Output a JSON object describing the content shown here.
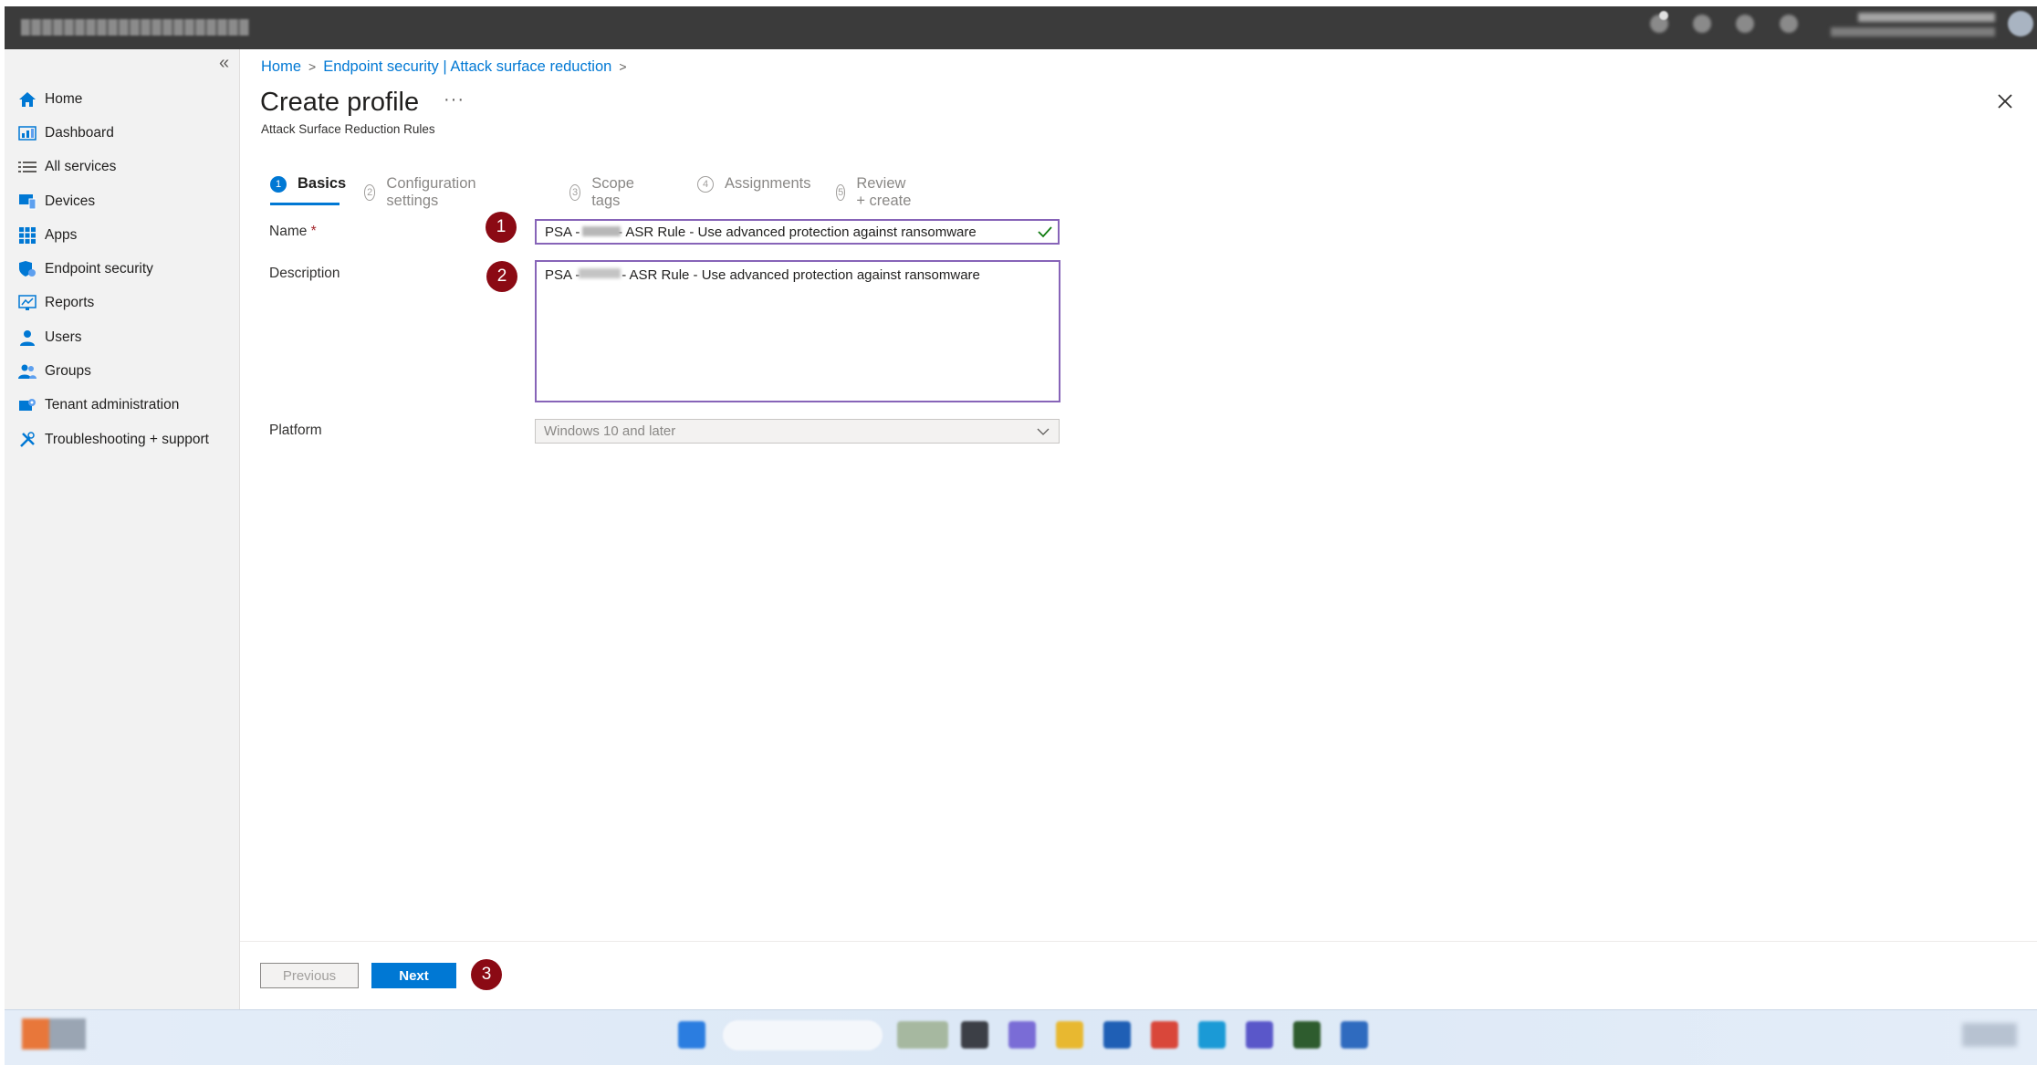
{
  "breadcrumb": {
    "home": "Home",
    "section": "Endpoint security | Attack surface reduction",
    "sep": ">"
  },
  "sidebar": {
    "collapse_glyph": "«",
    "items": [
      {
        "label": "Home",
        "icon": "home-icon",
        "color": "#0078d4"
      },
      {
        "label": "Dashboard",
        "icon": "dashboard-icon",
        "color": "#0078d4"
      },
      {
        "label": "All services",
        "icon": "list-icon",
        "color": "#605e5c"
      },
      {
        "label": "Devices",
        "icon": "devices-icon",
        "color": "#0078d4"
      },
      {
        "label": "Apps",
        "icon": "apps-icon",
        "color": "#0078d4"
      },
      {
        "label": "Endpoint security",
        "icon": "shield-icon",
        "color": "#0078d4"
      },
      {
        "label": "Reports",
        "icon": "reports-icon",
        "color": "#0078d4"
      },
      {
        "label": "Users",
        "icon": "user-icon",
        "color": "#0078d4"
      },
      {
        "label": "Groups",
        "icon": "groups-icon",
        "color": "#0078d4"
      },
      {
        "label": "Tenant administration",
        "icon": "tenant-icon",
        "color": "#0078d4"
      },
      {
        "label": "Troubleshooting + support",
        "icon": "wrench-icon",
        "color": "#0078d4"
      }
    ]
  },
  "page": {
    "title": "Create profile",
    "more": "···",
    "subtitle": "Attack Surface Reduction Rules"
  },
  "steps": [
    {
      "num": "1",
      "label": "Basics",
      "active": true
    },
    {
      "num": "2",
      "label": "Configuration settings",
      "active": false
    },
    {
      "num": "3",
      "label": "Scope tags",
      "active": false
    },
    {
      "num": "4",
      "label": "Assignments",
      "active": false
    },
    {
      "num": "5",
      "label": "Review + create",
      "active": false
    }
  ],
  "form": {
    "name_label": "Name",
    "required_mark": "*",
    "name_value": "PSA -          - ASR Rule - Use advanced protection against ransomware",
    "description_label": "Description",
    "description_value": "PSA -           - ASR Rule - Use advanced protection against ransomware",
    "platform_label": "Platform",
    "platform_value": "Windows 10 and later"
  },
  "markers": [
    "1",
    "2",
    "3"
  ],
  "footer": {
    "previous_label": "Previous",
    "next_label": "Next"
  },
  "colors": {
    "accent": "#0078d4",
    "marker": "#8b0a14",
    "input_border": "#8764b8",
    "valid_check": "#107c10"
  }
}
